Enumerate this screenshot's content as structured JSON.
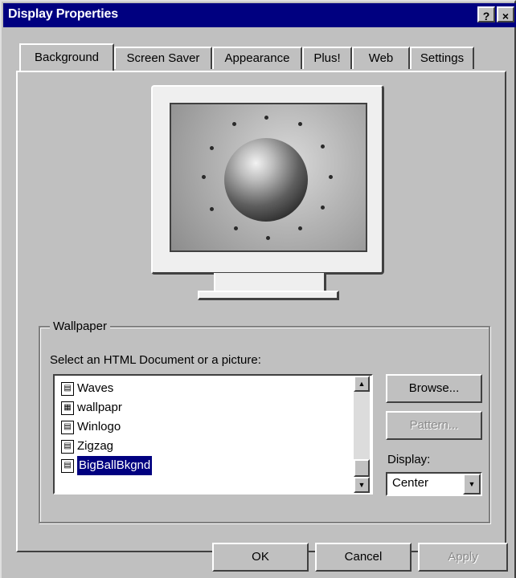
{
  "window": {
    "title": "Display Properties",
    "help_glyph": "?",
    "close_glyph": "×"
  },
  "tabs": [
    {
      "label": "Background",
      "active": true
    },
    {
      "label": "Screen Saver",
      "active": false
    },
    {
      "label": "Appearance",
      "active": false
    },
    {
      "label": "Plus!",
      "active": false
    },
    {
      "label": "Web",
      "active": false
    },
    {
      "label": "Settings",
      "active": false
    }
  ],
  "wallpaper": {
    "group_label": "Wallpaper",
    "prompt": "Select an HTML Document or a picture:",
    "items": [
      {
        "label": "Waves",
        "icon": "bitmap-file-icon"
      },
      {
        "label": "wallpapr",
        "icon": "html-file-icon"
      },
      {
        "label": "Winlogo",
        "icon": "bitmap-file-icon"
      },
      {
        "label": "Zigzag",
        "icon": "bitmap-file-icon"
      },
      {
        "label": "BigBallBkgnd",
        "icon": "bitmap-file-icon",
        "selected": true
      }
    ],
    "browse_label": "Browse...",
    "pattern_label": "Pattern...",
    "display_label": "Display:",
    "display_value": "Center"
  },
  "buttons": {
    "ok": "OK",
    "cancel": "Cancel",
    "apply": "Apply"
  },
  "colors": {
    "titlebar": "#000080",
    "face": "#c0c0c0",
    "selection": "#000080"
  }
}
